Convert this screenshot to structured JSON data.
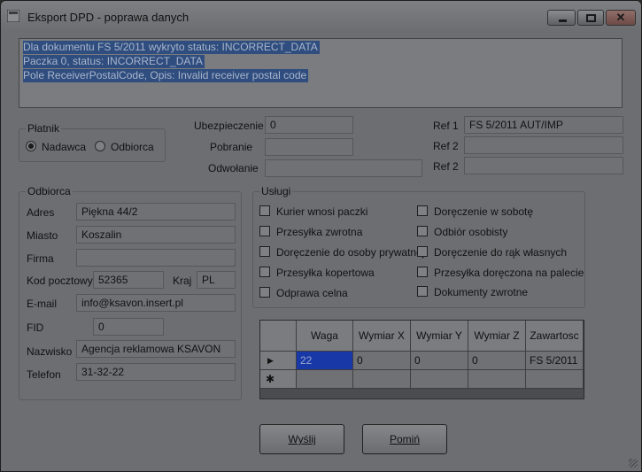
{
  "window": {
    "title": "Eksport DPD - poprawa danych"
  },
  "log": {
    "lines": [
      "Dla dokumentu FS 5/2011 wykryto status: INCORRECT_DATA",
      "Paczka 0, status: INCORRECT_DATA",
      "Pole ReceiverPostalCode, Opis: Invalid receiver postal code"
    ]
  },
  "payer": {
    "title": "Płatnik",
    "options": [
      {
        "label": "Nadawca",
        "selected": true
      },
      {
        "label": "Odbiorca",
        "selected": false
      }
    ]
  },
  "misc": {
    "insurance_label": "Ubezpieczenie",
    "insurance_value": "0",
    "cod_label": "Pobranie",
    "cod_value": "",
    "reference_label": "Odwołanie",
    "reference_value": ""
  },
  "refs": [
    {
      "label": "Ref 1",
      "value": "FS 5/2011 AUT/IMP"
    },
    {
      "label": "Ref 2",
      "value": ""
    },
    {
      "label": "Ref 2",
      "value": ""
    }
  ],
  "receiver": {
    "title": "Odbiorca",
    "address_label": "Adres",
    "address": "Piękna  44/2",
    "city_label": "Miasto",
    "city": "Koszalin",
    "company_label": "Firma",
    "company": "",
    "postal_label": "Kod pocztowy",
    "postal": "52365",
    "country_label": "Kraj",
    "country": "PL",
    "email_label": "E-mail",
    "email": "info@ksavon.insert.pl",
    "fid_label": "FID",
    "fid": "0",
    "name_label": "Nazwisko",
    "name": "Agencja reklamowa KSAVON",
    "phone_label": "Telefon",
    "phone": "31-32-22"
  },
  "services": {
    "title": "Usługi",
    "left": [
      {
        "label": "Kurier wnosi paczki",
        "checked": false
      },
      {
        "label": "Przesyłka zwrotna",
        "checked": false
      },
      {
        "label": "Doręczenie do osoby prywatnej",
        "checked": false
      },
      {
        "label": "Przesyłka kopertowa",
        "checked": false
      },
      {
        "label": "Odprawa celna",
        "checked": false
      }
    ],
    "right": [
      {
        "label": "Doręczenie w sobotę",
        "checked": false
      },
      {
        "label": "Odbiór osobisty",
        "checked": false
      },
      {
        "label": "Doręczenie do rąk własnych",
        "checked": false
      },
      {
        "label": "Przesyłka doręczona na palecie",
        "checked": false
      },
      {
        "label": "Dokumenty zwrotne",
        "checked": false
      }
    ]
  },
  "packages": {
    "columns": [
      "Waga",
      "Wymiar X",
      "Wymiar Y",
      "Wymiar Z",
      "Zawartosc"
    ],
    "rows": [
      [
        "22",
        "0",
        "0",
        "0",
        "FS 5/2011"
      ]
    ],
    "current_row_marker": "▶",
    "new_row_marker": "✱"
  },
  "buttons": {
    "send": "Wyślij",
    "skip": "Pomiń"
  },
  "colors": {
    "selection": "#1838a8",
    "log_highlight": "#2f4d7e",
    "background": "#6c6e72"
  }
}
